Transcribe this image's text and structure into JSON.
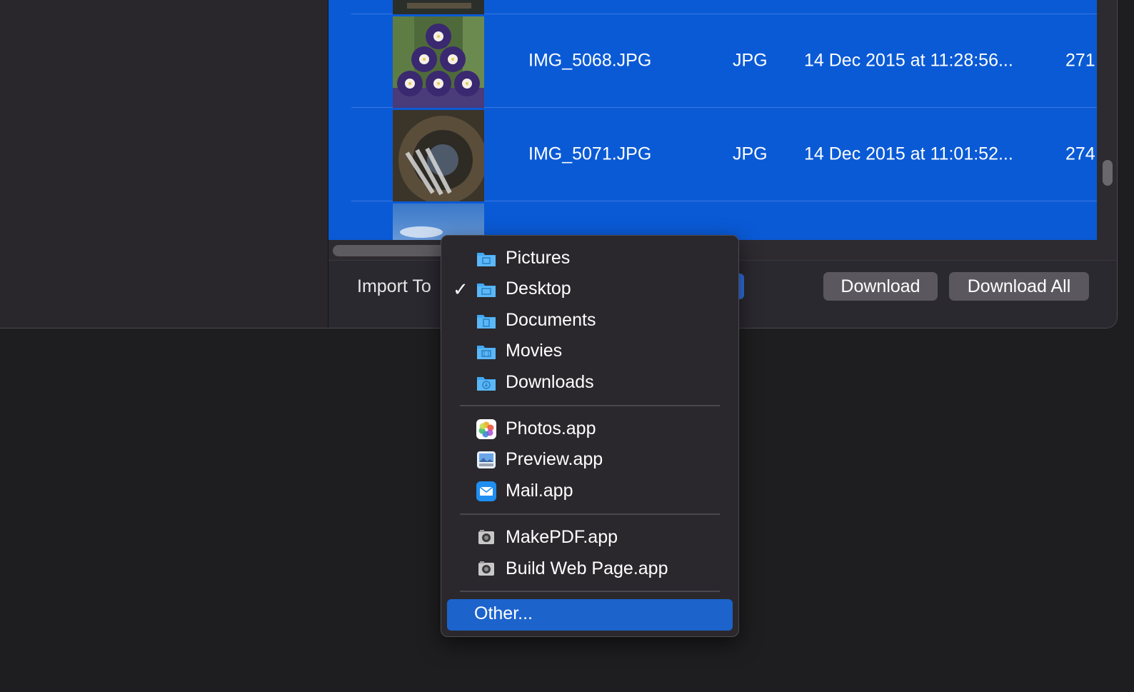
{
  "files": [
    {
      "name": "IMG_5068.JPG",
      "kind": "JPG",
      "date": "14 Dec 2015 at 11:28:56...",
      "size": "271",
      "thumb": "flowers-thumbnail"
    },
    {
      "name": "IMG_5071.JPG",
      "kind": "JPG",
      "date": "14 Dec 2015 at 11:01:52...",
      "size": "274",
      "thumb": "staircase-thumbnail"
    }
  ],
  "bottom_bar": {
    "import_label": "Import To",
    "download_label": "Download",
    "download_all_label": "Download All"
  },
  "menu": {
    "selected": "Desktop",
    "highlighted": "Other...",
    "groups": [
      [
        {
          "label": "Pictures",
          "icon": "folder-pictures-icon"
        },
        {
          "label": "Desktop",
          "icon": "folder-desktop-icon"
        },
        {
          "label": "Documents",
          "icon": "folder-documents-icon"
        },
        {
          "label": "Movies",
          "icon": "folder-movies-icon"
        },
        {
          "label": "Downloads",
          "icon": "folder-downloads-icon"
        }
      ],
      [
        {
          "label": "Photos.app",
          "icon": "photos-app-icon"
        },
        {
          "label": "Preview.app",
          "icon": "preview-app-icon"
        },
        {
          "label": "Mail.app",
          "icon": "mail-app-icon"
        }
      ],
      [
        {
          "label": "MakePDF.app",
          "icon": "automator-app-icon"
        },
        {
          "label": "Build Web Page.app",
          "icon": "automator-app-icon"
        }
      ],
      [
        {
          "label": "Other..."
        }
      ]
    ],
    "check_glyph": "✓"
  },
  "colors": {
    "selection_blue": "#0a5ad6",
    "menu_highlight": "#1c63cc",
    "folder_blue": "#3fa9f5"
  }
}
